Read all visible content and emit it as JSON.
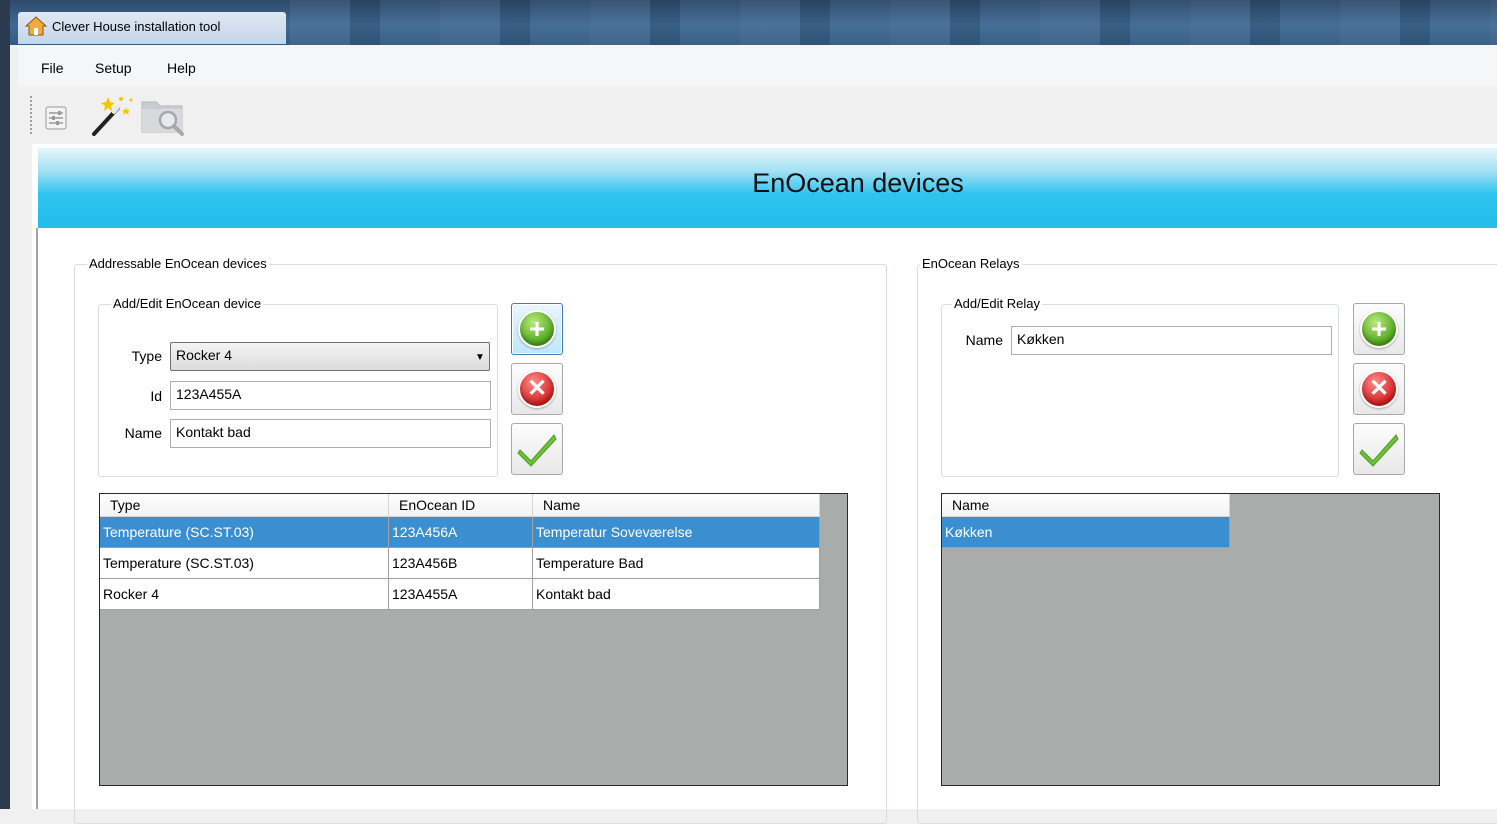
{
  "window": {
    "title": "Clever House installation tool",
    "icon": "house-icon"
  },
  "menu": {
    "items": [
      "File",
      "Setup",
      "Help"
    ]
  },
  "toolbar": {
    "icons": [
      "settings-sliders-icon",
      "magic-wand-icon",
      "folder-search-icon"
    ]
  },
  "banner": {
    "title": "EnOcean devices",
    "colors": [
      "#e6f6fc",
      "#22bdea"
    ]
  },
  "devices": {
    "group_title": "Addressable EnOcean devices",
    "edit": {
      "title": "Add/Edit EnOcean device",
      "type_label": "Type",
      "type_value": "Rocker 4",
      "id_label": "Id",
      "id_value": "123A455A",
      "name_label": "Name",
      "name_value": "Kontakt bad"
    },
    "columns": [
      "Type",
      "EnOcean ID",
      "Name"
    ],
    "rows": [
      {
        "type": "Temperature (SC.ST.03)",
        "id": "123A456A",
        "name": "Temperatur Soveværelse",
        "selected": true
      },
      {
        "type": "Temperature (SC.ST.03)",
        "id": "123A456B",
        "name": "Temperature Bad",
        "selected": false
      },
      {
        "type": "Rocker 4",
        "id": "123A455A",
        "name": "Kontakt bad",
        "selected": false
      }
    ]
  },
  "relays": {
    "group_title": "EnOcean Relays",
    "edit": {
      "title": "Add/Edit Relay",
      "name_label": "Name",
      "name_value": "Køkken"
    },
    "columns": [
      "Name"
    ],
    "rows": [
      {
        "name": "Køkken",
        "selected": true
      }
    ]
  },
  "colors": {
    "selection": "#3b8fd1",
    "grid_background": "#aaabab"
  }
}
